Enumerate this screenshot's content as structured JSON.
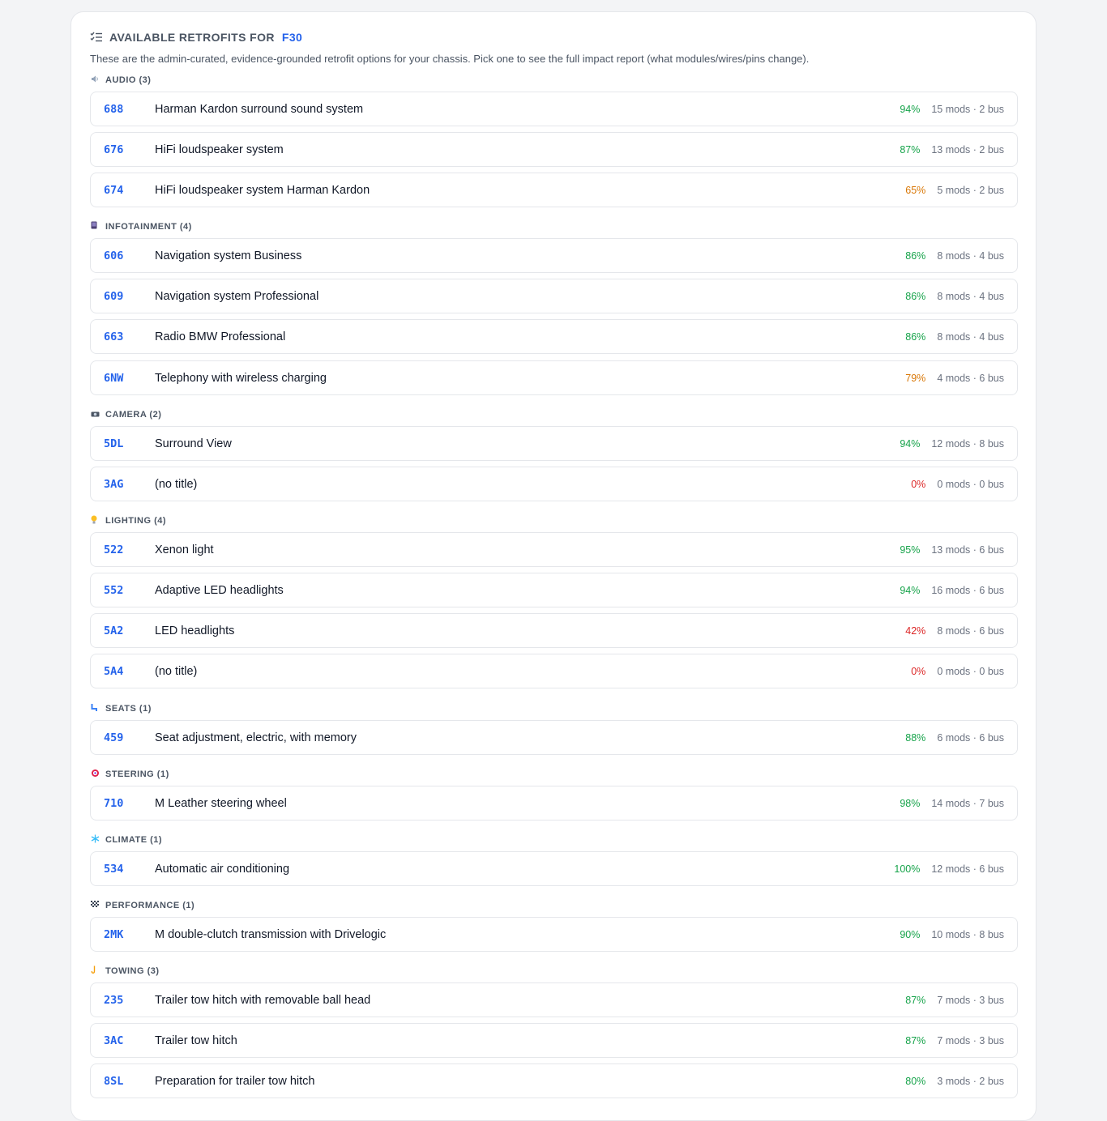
{
  "header": {
    "title": "AVAILABLE RETROFITS FOR",
    "chassis": "F30",
    "subtitle": "These are the admin-curated, evidence-grounded retrofit options for your chassis. Pick one to see the full impact report (what modules/wires/pins change)."
  },
  "colors": {
    "accent": "#2563eb",
    "green": "#16a34a",
    "amber": "#d97706",
    "red": "#dc2626"
  },
  "categories": [
    {
      "label": "AUDIO (3)",
      "icon": "speaker-icon"
    },
    {
      "label": "INFOTAINMENT (4)",
      "icon": "infotainment-icon"
    },
    {
      "label": "CAMERA (2)",
      "icon": "camera-icon"
    },
    {
      "label": "LIGHTING (4)",
      "icon": "lightbulb-icon"
    },
    {
      "label": "SEATS (1)",
      "icon": "seat-icon"
    },
    {
      "label": "STEERING (1)",
      "icon": "steering-icon"
    },
    {
      "label": "CLIMATE (1)",
      "icon": "snowflake-icon"
    },
    {
      "label": "PERFORMANCE (1)",
      "icon": "checkered-flag-icon"
    },
    {
      "label": "TOWING (3)",
      "icon": "hook-icon"
    }
  ],
  "rows": [
    {
      "code": "688",
      "name": "Harman Kardon surround sound system",
      "pct": "94%",
      "meta": "15 mods · 2 bus"
    },
    {
      "code": "676",
      "name": "HiFi loudspeaker system",
      "pct": "87%",
      "meta": "13 mods · 2 bus"
    },
    {
      "code": "674",
      "name": "HiFi loudspeaker system Harman Kardon",
      "pct": "65%",
      "meta": "5 mods · 2 bus"
    },
    {
      "code": "606",
      "name": "Navigation system Business",
      "pct": "86%",
      "meta": "8 mods · 4 bus"
    },
    {
      "code": "609",
      "name": "Navigation system Professional",
      "pct": "86%",
      "meta": "8 mods · 4 bus"
    },
    {
      "code": "663",
      "name": "Radio BMW Professional",
      "pct": "86%",
      "meta": "8 mods · 4 bus"
    },
    {
      "code": "6NW",
      "name": "Telephony with wireless charging",
      "pct": "79%",
      "meta": "4 mods · 6 bus"
    },
    {
      "code": "5DL",
      "name": "Surround View",
      "pct": "94%",
      "meta": "12 mods · 8 bus"
    },
    {
      "code": "3AG",
      "name": "(no title)",
      "pct": "0%",
      "meta": "0 mods · 0 bus"
    },
    {
      "code": "522",
      "name": "Xenon light",
      "pct": "95%",
      "meta": "13 mods · 6 bus"
    },
    {
      "code": "552",
      "name": "Adaptive LED headlights",
      "pct": "94%",
      "meta": "16 mods · 6 bus"
    },
    {
      "code": "5A2",
      "name": "LED headlights",
      "pct": "42%",
      "meta": "8 mods · 6 bus"
    },
    {
      "code": "5A4",
      "name": "(no title)",
      "pct": "0%",
      "meta": "0 mods · 0 bus"
    },
    {
      "code": "459",
      "name": "Seat adjustment, electric, with memory",
      "pct": "88%",
      "meta": "6 mods · 6 bus"
    },
    {
      "code": "710",
      "name": "M Leather steering wheel",
      "pct": "98%",
      "meta": "14 mods · 7 bus"
    },
    {
      "code": "534",
      "name": "Automatic air conditioning",
      "pct": "100%",
      "meta": "12 mods · 6 bus"
    },
    {
      "code": "2MK",
      "name": "M double-clutch transmission with Drivelogic",
      "pct": "90%",
      "meta": "10 mods · 8 bus"
    },
    {
      "code": "235",
      "name": "Trailer tow hitch with removable ball head",
      "pct": "87%",
      "meta": "7 mods · 3 bus"
    },
    {
      "code": "3AC",
      "name": "Trailer tow hitch",
      "pct": "87%",
      "meta": "7 mods · 3 bus"
    },
    {
      "code": "8SL",
      "name": "Preparation for trailer tow hitch",
      "pct": "80%",
      "meta": "3 mods · 2 bus"
    }
  ]
}
